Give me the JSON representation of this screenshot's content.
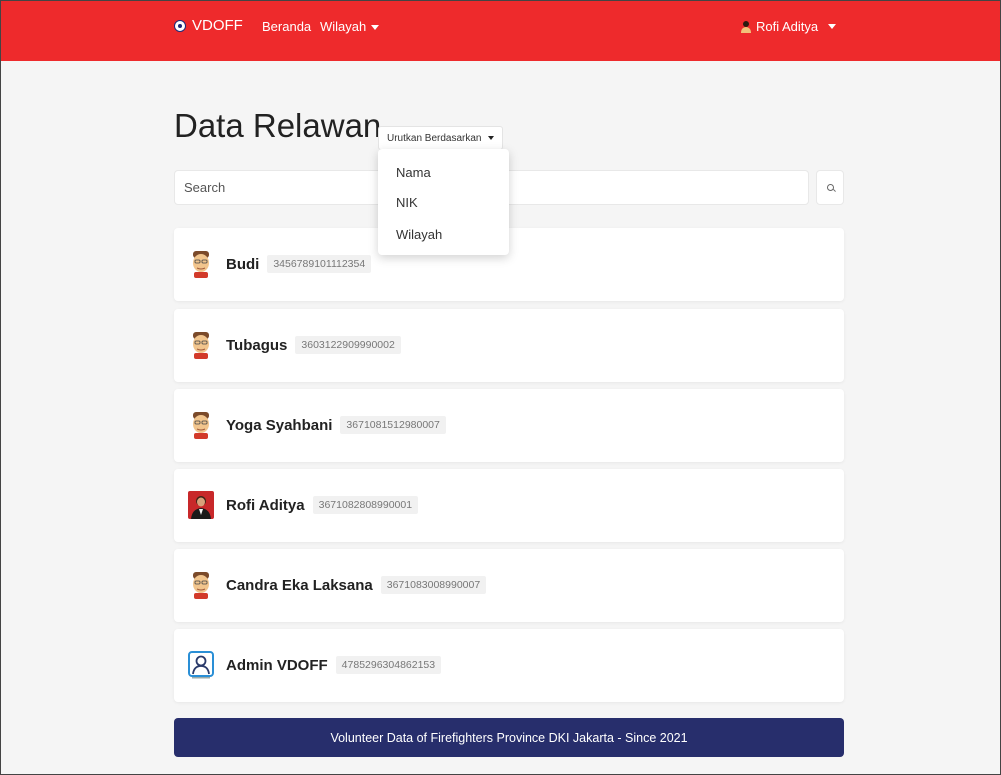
{
  "navbar": {
    "brand": "VDOFF",
    "home_label": "Beranda",
    "region_label": "Wilayah",
    "user_label": "Rofi Aditya",
    "color": "#ee2a2c"
  },
  "page": {
    "title": "Data Relawan",
    "sort_label": "Urutkan Berdasarkan",
    "sort_options": [
      "Nama",
      "NIK",
      "Wilayah"
    ]
  },
  "search": {
    "placeholder": "Search",
    "value": "",
    "button_icon": "search-icon"
  },
  "volunteers": [
    {
      "name": "Budi",
      "nik": "3456789101112354",
      "avatar": "cartoon-face-icon"
    },
    {
      "name": "Tubagus",
      "nik": "3603122909990002",
      "avatar": "cartoon-face-icon"
    },
    {
      "name": "Yoga Syahbani",
      "nik": "3671081512980007",
      "avatar": "cartoon-face-icon"
    },
    {
      "name": "Rofi Aditya",
      "nik": "3671082808990001",
      "avatar": "photo-portrait-icon"
    },
    {
      "name": "Candra Eka Laksana",
      "nik": "3671083008990007",
      "avatar": "cartoon-face-icon"
    },
    {
      "name": "Admin VDOFF",
      "nik": "4785296304862153",
      "avatar": "person-outline-icon"
    }
  ],
  "footer": {
    "text": "Volunteer Data of Firefighters Province DKI Jakarta - Since 2021",
    "color": "#272e6c"
  }
}
